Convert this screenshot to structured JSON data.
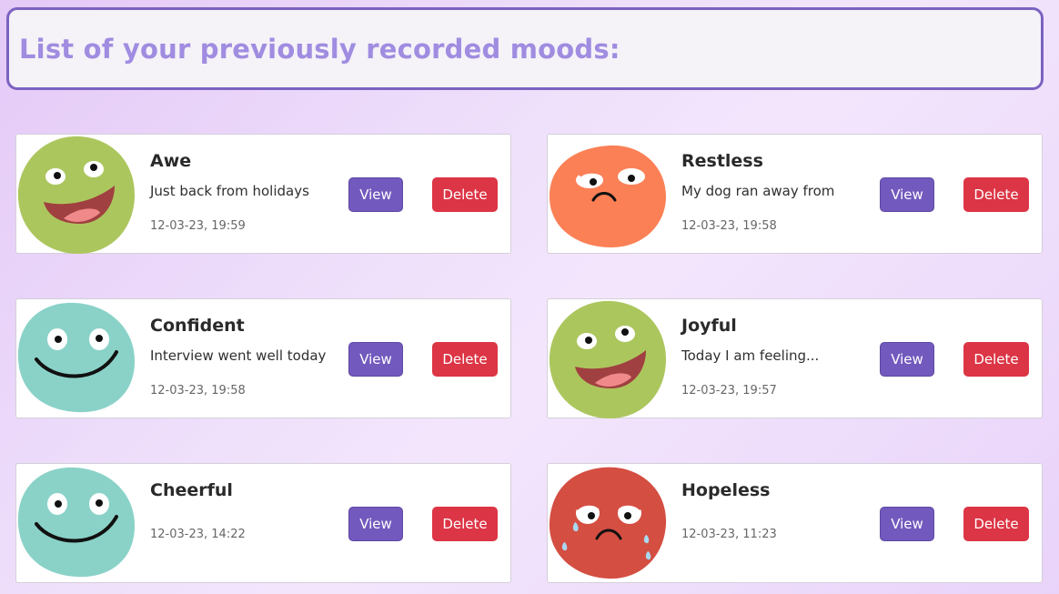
{
  "header": {
    "title": "List of your previously recorded moods:"
  },
  "buttons": {
    "view": "View",
    "delete": "Delete"
  },
  "colors": {
    "accent": "#7259bd",
    "danger": "#dc3545",
    "header_text": "#a08ce0"
  },
  "moods": [
    {
      "title": "Awe",
      "note": "Just back from holidays",
      "date": "12-03-23, 19:59",
      "face": "happy-green-face"
    },
    {
      "title": "Restless",
      "note": "My dog ran away from",
      "date": "12-03-23, 19:58",
      "face": "worried-orange-face"
    },
    {
      "title": "Confident",
      "note": "Interview went well today",
      "date": "12-03-23, 19:58",
      "face": "smiling-teal-face"
    },
    {
      "title": "Joyful",
      "note": "Today I am feeling...",
      "date": "12-03-23, 19:57",
      "face": "happy-green-face"
    },
    {
      "title": "Cheerful",
      "note": "",
      "date": "12-03-23, 14:22",
      "face": "smiling-teal-face"
    },
    {
      "title": "Hopeless",
      "note": "",
      "date": "12-03-23, 11:23",
      "face": "crying-red-face"
    }
  ]
}
